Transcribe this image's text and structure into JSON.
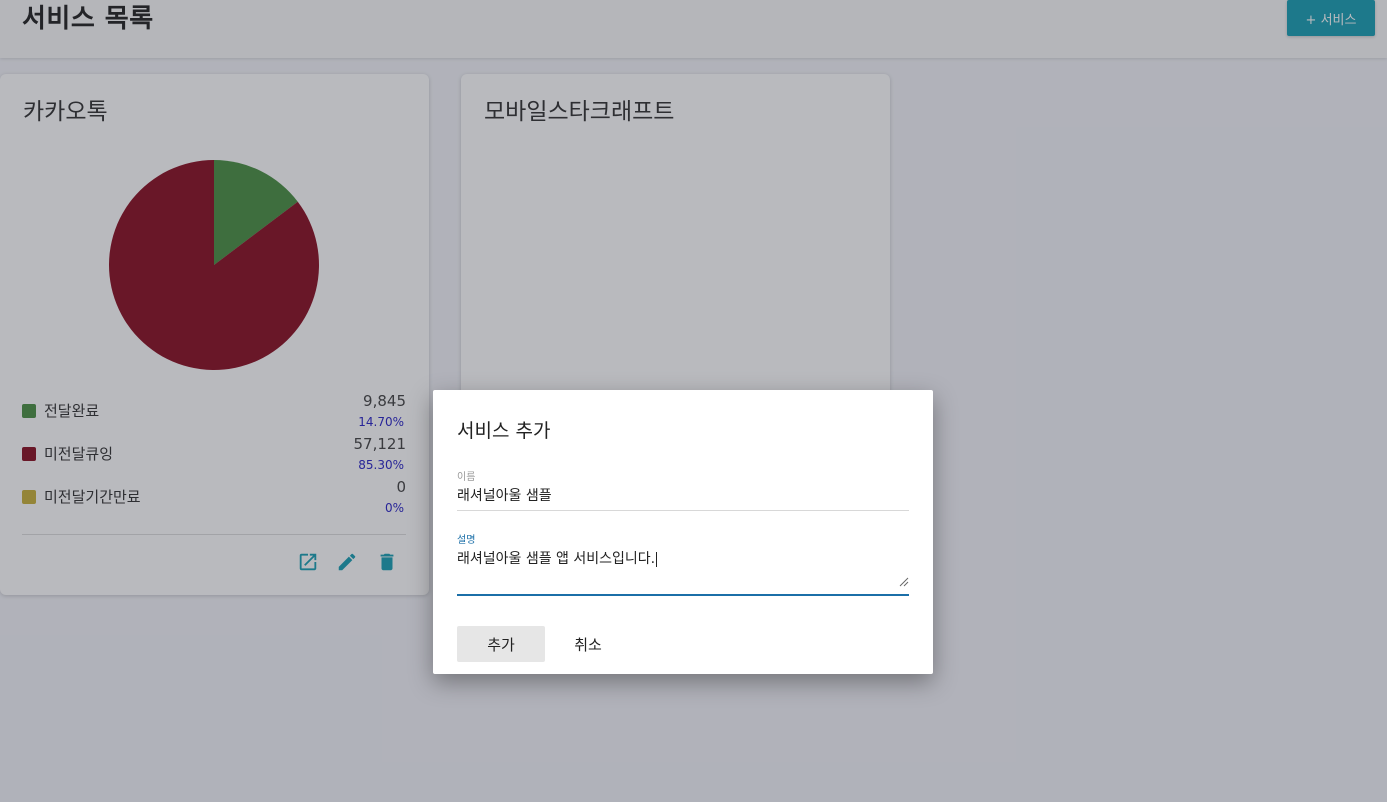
{
  "header": {
    "title": "서비스 목록",
    "add_button_label": "+ 서비스"
  },
  "cards": [
    {
      "title": "카카오톡",
      "legend": [
        {
          "label": "전달완료",
          "count": "9,845",
          "percent": "14.70%",
          "color": "#4a8f43"
        },
        {
          "label": "미전달큐잉",
          "count": "57,121",
          "percent": "85.30%",
          "color": "#8a0f23"
        },
        {
          "label": "미전달기간만료",
          "count": "0",
          "percent": "0%",
          "color": "#c9b13a"
        }
      ],
      "actions": [
        {
          "name": "open-external-icon"
        },
        {
          "name": "edit-pencil-icon"
        },
        {
          "name": "delete-trash-icon"
        }
      ]
    },
    {
      "title": "모바일스타크래프트"
    }
  ],
  "chart_data": {
    "type": "pie",
    "categories": [
      "전달완료",
      "미전달큐잉",
      "미전달기간만료"
    ],
    "values": [
      9845,
      57121,
      0
    ],
    "percentages": [
      14.7,
      85.3,
      0
    ],
    "colors": [
      "#4a8f43",
      "#8a0f23",
      "#c9b13a"
    ]
  },
  "dialog": {
    "title": "서비스 추가",
    "name_label": "이름",
    "name_value": "래셔널아울 샘플",
    "description_label": "설명",
    "description_value": "래셔널아울 샘플 앱 서비스입니다.",
    "confirm_label": "추가",
    "cancel_label": "취소"
  },
  "colors": {
    "accent": "#1aa0b4",
    "focus": "#1b6fa8",
    "percent_text": "#2a24c7"
  }
}
